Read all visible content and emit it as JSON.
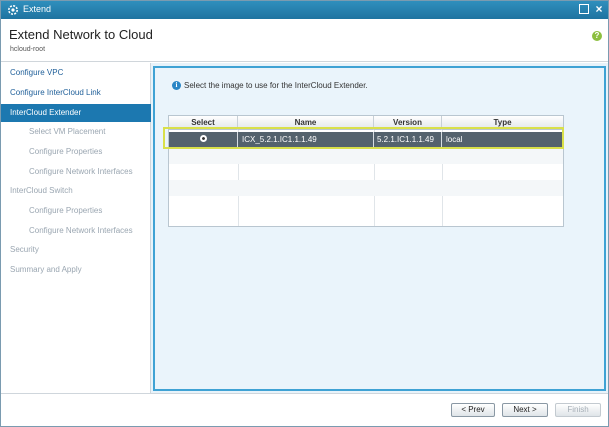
{
  "window": {
    "title": "Extend",
    "icon": "gear-icon",
    "controls": [
      "maximize-icon",
      "close-icon"
    ]
  },
  "header": {
    "title": "Extend Network to Cloud",
    "subtitle": "hcloud-root",
    "help_symbol": "?"
  },
  "sidebar": {
    "items": [
      {
        "label": "Configure VPC",
        "state": "done",
        "level": 0
      },
      {
        "label": "Configure InterCloud Link",
        "state": "done",
        "level": 0
      },
      {
        "label": "InterCloud Extender",
        "state": "active",
        "level": 0
      },
      {
        "label": "Select VM Placement",
        "state": "future",
        "level": 1
      },
      {
        "label": "Configure Properties",
        "state": "future",
        "level": 1
      },
      {
        "label": "Configure Network Interfaces",
        "state": "future",
        "level": 1
      },
      {
        "label": "InterCloud Switch",
        "state": "future",
        "level": 0
      },
      {
        "label": "Configure Properties",
        "state": "future",
        "level": 1
      },
      {
        "label": "Configure Network Interfaces",
        "state": "future",
        "level": 1
      },
      {
        "label": "Security",
        "state": "future",
        "level": 0
      },
      {
        "label": "Summary and Apply",
        "state": "future",
        "level": 0
      }
    ]
  },
  "main": {
    "info_symbol": "i",
    "instruction": "Select the image to use for the InterCloud Extender.",
    "table": {
      "columns": [
        "Select",
        "Name",
        "Version",
        "Type"
      ],
      "rows": [
        {
          "selected": true,
          "name": "ICX_5.2.1.IC1.1.1.49",
          "version": "5.2.1.IC1.1.1.49",
          "type": "local"
        }
      ]
    }
  },
  "footer": {
    "prev_label": "< Prev",
    "next_label": "Next >",
    "finish_label": "Finish"
  },
  "colors": {
    "titlebar": "#1f73a0",
    "active_nav": "#1c78b0",
    "panel_border": "#3fa2d4",
    "selected_row": "#54626d",
    "highlight": "#d9e04a"
  }
}
